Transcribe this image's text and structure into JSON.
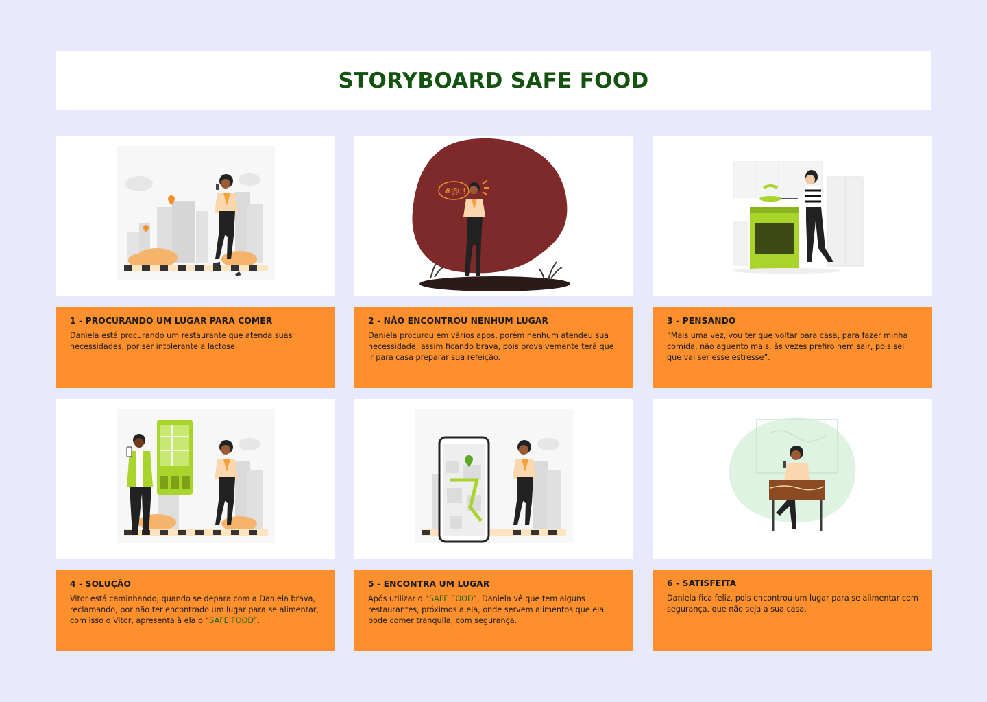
{
  "page": {
    "title": "STORYBOARD SAFE FOOD"
  },
  "colors": {
    "background": "#e9e9fd",
    "card": "#fe8f2d",
    "title": "#14520f",
    "accent_green": "#a8d42b",
    "maroon": "#7f2a2a"
  },
  "panels": [
    {
      "title": "1 - PROCURANDO UM LUGAR PARA COMER",
      "text": "Daniela está procurando um restaurante que atenda suas necessidades, por ser intolerante a lactose."
    },
    {
      "title": "2 - NÃO ENCONTROU NENHUM LUGAR",
      "text": "Daniela procurou em vários apps, porém nenhum atendeu sua necessidade, assim ficando brava, pois provalvemente terá que ir para casa preparar sua refeição.",
      "bubble": "#@!!"
    },
    {
      "title": "3 - PENSANDO",
      "text": "“Mais uma vez, vou ter que voltar para casa, para fazer minha comida, não aguento mais, às vezes prefiro nem sair, pois sei que vai ser esse estresse”."
    },
    {
      "title": "4 - SOLUÇÃO",
      "text_before": "Vitor está caminhando, quando se depara com a Daniela brava, reclamando, por não ter encontrado um lugar para se alimentar, com isso o Vitor, apresenta à ela o “",
      "highlight": "SAFE FOOD",
      "text_after": "”."
    },
    {
      "title": "5 - ENCONTRA UM LUGAR",
      "text_before": "Após utilizar o “",
      "highlight": "SAFE FOOD",
      "text_after": "”, Daniela vê que tem alguns restaurantes, próximos a ela, onde servem alimentos que ela pode comer tranquila, com segurança."
    },
    {
      "title": "6 - SATISFEITA",
      "text": "Daniela fica feliz, pois encontrou um lugar para se alimentar com segurança, que não seja a sua casa."
    }
  ]
}
